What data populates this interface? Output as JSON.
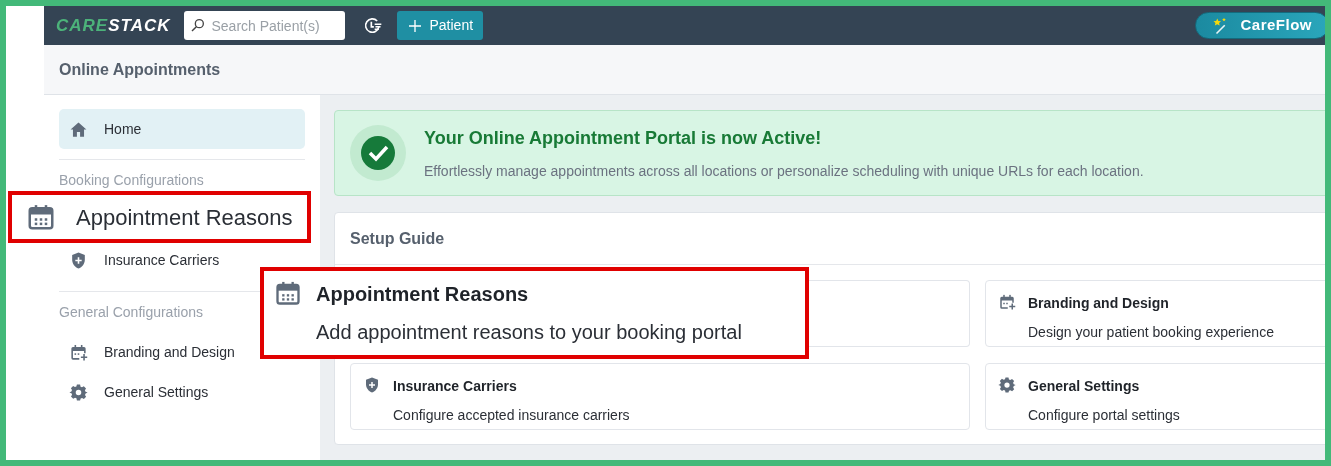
{
  "topbar": {
    "logo": [
      "CARE",
      "STACK"
    ],
    "search": {
      "placeholder": "Search Patient(s)"
    },
    "patient_button": "Patient",
    "careflow_button": "CareFlow"
  },
  "page_title": "Online Appointments",
  "sidebar": {
    "home": {
      "label": "Home",
      "selected": true
    },
    "groups": [
      {
        "heading": "Booking Configurations",
        "items": [
          {
            "kind": "calendar-callout",
            "label": "Appointment Reasons"
          },
          {
            "kind": "shield",
            "label": "Insurance Carriers"
          }
        ]
      },
      {
        "heading": "General Configurations",
        "items": [
          {
            "kind": "calendar-plus",
            "label": "Branding and Design"
          },
          {
            "kind": "gear",
            "label": "General Settings"
          }
        ]
      }
    ]
  },
  "banner": {
    "title": "Your Online Appointment Portal is now Active!",
    "description": "Effortlessly manage appointments across all locations or personalize scheduling with unique URLs for each location."
  },
  "setup_guide": {
    "title": "Setup Guide",
    "cards": [
      {
        "kind": "calendar-callout",
        "title": "Appointment Reasons",
        "description": "Add appointment reasons to your booking portal"
      },
      {
        "kind": "calendar-plus",
        "title": "Branding and Design",
        "description": "Design your patient booking experience"
      },
      {
        "kind": "shield",
        "title": "Insurance Carriers",
        "description": "Configure accepted insurance carriers"
      },
      {
        "kind": "gear",
        "title": "General Settings",
        "description": "Configure portal settings"
      }
    ]
  }
}
